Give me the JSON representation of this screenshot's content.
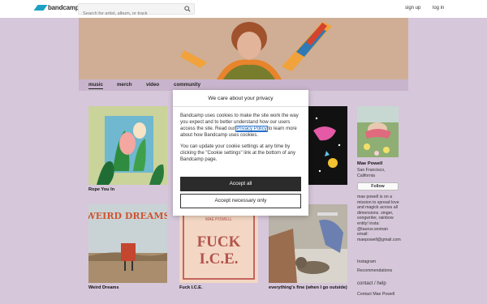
{
  "header": {
    "logo_text": "bandcamp",
    "search_placeholder": "Search for artist, album, or track",
    "signup": "sign up",
    "login": "log in"
  },
  "nav": {
    "items": [
      "music",
      "merch",
      "video",
      "community"
    ]
  },
  "albums": [
    {
      "title": "Rope You In"
    },
    {
      "title": ""
    },
    {
      "title": ""
    },
    {
      "title": "Weird Dreams"
    },
    {
      "title": "Fuck I.C.E."
    },
    {
      "title": "everything's fine (when I go outside)"
    }
  ],
  "album_cover_text": {
    "weird_dreams": "WEIRD DREAMS",
    "fuck_ice_line1": "FUCK",
    "fuck_ice_line2": "I.C.E.",
    "fuck_ice_top": "MAE POWELL"
  },
  "sidebar": {
    "artist_name": "Mae Powell",
    "location": "San Francisco, California",
    "follow": "Follow",
    "bio": "mae powell is on a mission to spread love and magick across all dimensions. singer, songwriter, rainbow entity! insta: @taurus.woman email: maepowell@gmail.com",
    "instagram": "Instagram",
    "recommendations": "Recommendations",
    "contact_heading": "contact / help",
    "contact_link": "Contact Mae Powell"
  },
  "cookie_modal": {
    "title": "We care about your privacy",
    "body1_before": "Bandcamp uses cookies to make the site work the way you expect and to better understand how our users access the site. Read our ",
    "policy_link": "Privacy Policy",
    "body1_after": " to learn more about how Bandcamp uses cookies.",
    "body2": "You can update your cookie settings at any time by clicking the \"Cookie settings\" link at the bottom of any Bandcamp page.",
    "accept_all": "Accept all",
    "accept_necessary": "Accept necessary only"
  },
  "colors": {
    "page_bg": "#d6c7da",
    "nav_bg": "#c8b5cd",
    "logo": "#1da0c3",
    "accept_button": "#2b2b2b",
    "link": "#0b5dbb"
  }
}
